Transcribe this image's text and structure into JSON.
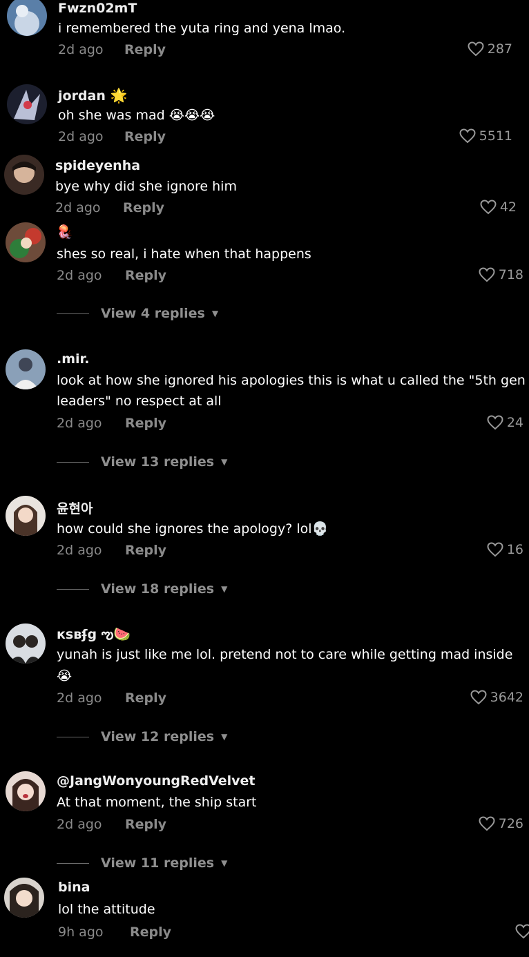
{
  "comments": [
    {
      "username": "Fwzn02mT",
      "text": "i remembered the yuta ring and yena lmao.",
      "time": "2d ago",
      "reply": "Reply",
      "likes": "287"
    },
    {
      "username": "jordan",
      "username_emoji": "🌟",
      "text": "oh she was mad 😭😭😭",
      "time": "2d ago",
      "reply": "Reply",
      "likes": "5511"
    },
    {
      "username": "spideyenha",
      "text": "bye why did she ignore him",
      "time": "2d ago",
      "reply": "Reply",
      "likes": "42"
    },
    {
      "username": "🪼",
      "text": "shes so real, i hate when that happens",
      "time": "2d ago",
      "reply": "Reply",
      "likes": "718",
      "view_replies": "View 4 replies"
    },
    {
      "username": ".mir.",
      "text_line1": "look at how she ignored his apologies this is what u called the \"5th gen",
      "text_line2": "leaders\" no respect at all",
      "time": "2d ago",
      "reply": "Reply",
      "likes": "24",
      "view_replies": "View 13 replies"
    },
    {
      "username": "윤현아",
      "text": "how could she ignores the apology? lol💀",
      "time": "2d ago",
      "reply": "Reply",
      "likes": "16",
      "view_replies": "View 18 replies"
    },
    {
      "username": "кsвʄg ",
      "username_emoji": "ఌ🍉",
      "text_line1": "yunah is just like me lol. pretend not to care while getting mad inside",
      "text_line2": "😭",
      "time": "2d ago",
      "reply": "Reply",
      "likes": "3642",
      "view_replies": "View 12 replies"
    },
    {
      "username": "@JangWonyoungRedVelvet",
      "text": "At that moment, the ship start",
      "time": "2d ago",
      "reply": "Reply",
      "likes": "726",
      "view_replies": "View 11 replies"
    },
    {
      "username": "bina",
      "text": "lol the attitude",
      "time": "9h ago",
      "reply": "Reply"
    }
  ]
}
